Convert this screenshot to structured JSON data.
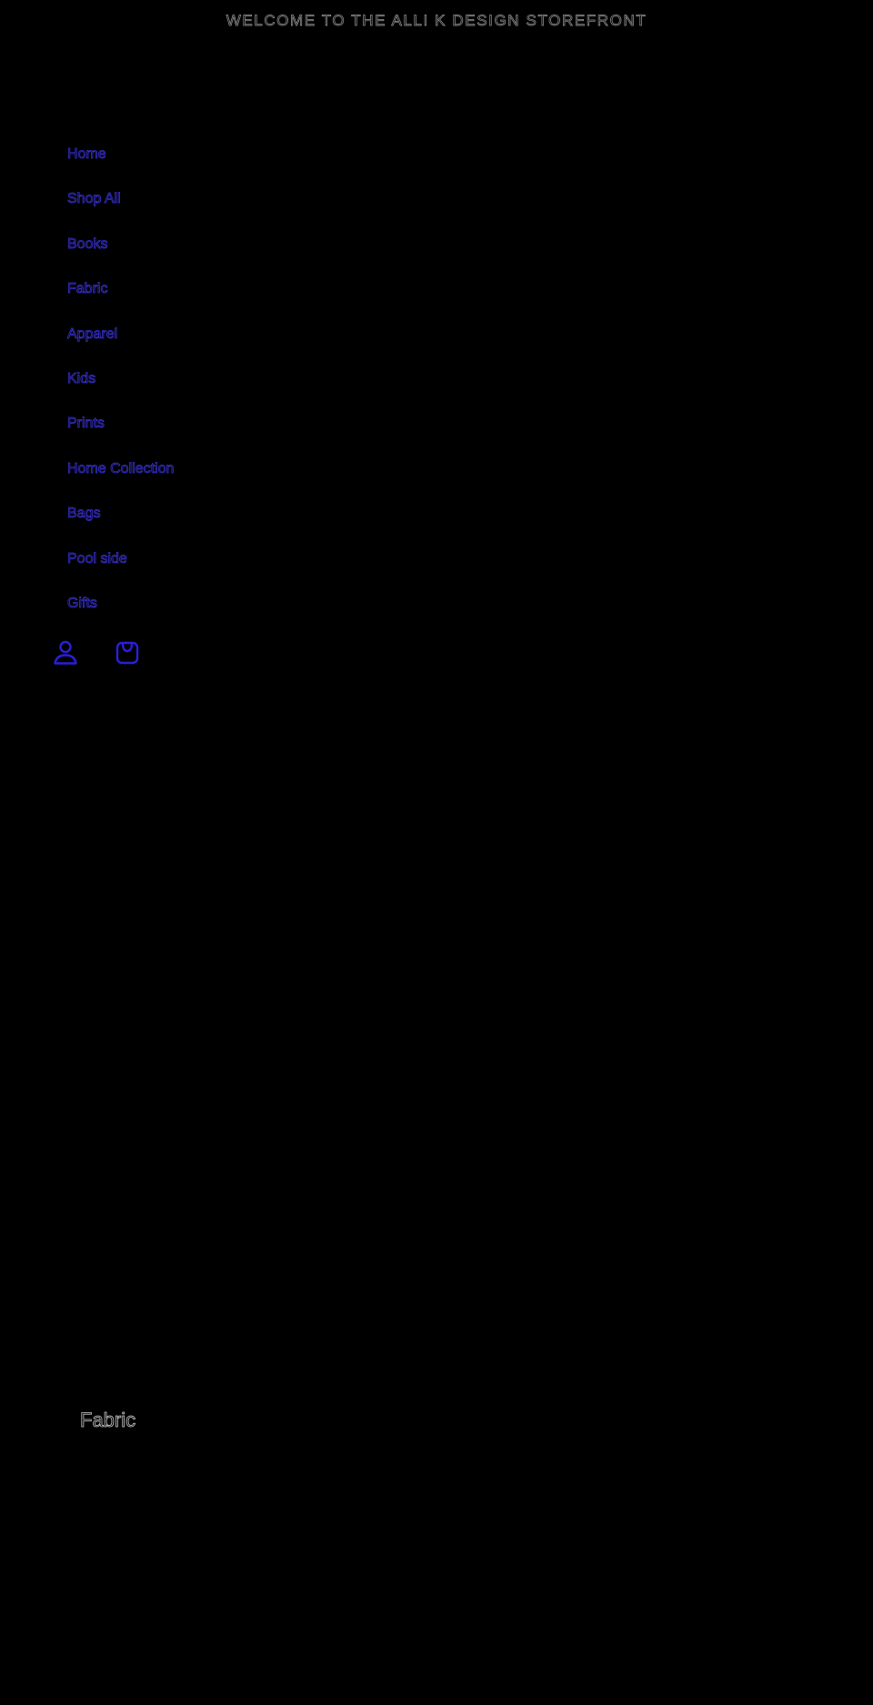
{
  "announcement": {
    "text": "WELCOME TO THE ALLI K DESIGN STOREFRONT"
  },
  "nav": {
    "items": [
      {
        "label": "Home"
      },
      {
        "label": "Shop All"
      },
      {
        "label": "Books"
      },
      {
        "label": "Fabric"
      },
      {
        "label": "Apparel"
      },
      {
        "label": "Kids"
      },
      {
        "label": "Prints"
      },
      {
        "label": "Home Collection"
      },
      {
        "label": "Bags"
      },
      {
        "label": "Pool side"
      },
      {
        "label": "Gifts"
      }
    ]
  },
  "header_icons": [
    {
      "icon": "account-icon"
    },
    {
      "icon": "cart-icon"
    }
  ],
  "collection": {
    "title": "Fabric"
  },
  "colors": {
    "background": "#000000",
    "nav_link": "#3a32d6",
    "icon": "#2a1fd9",
    "heading": "#c8c8c8",
    "announcement": "#9a9a9a"
  }
}
